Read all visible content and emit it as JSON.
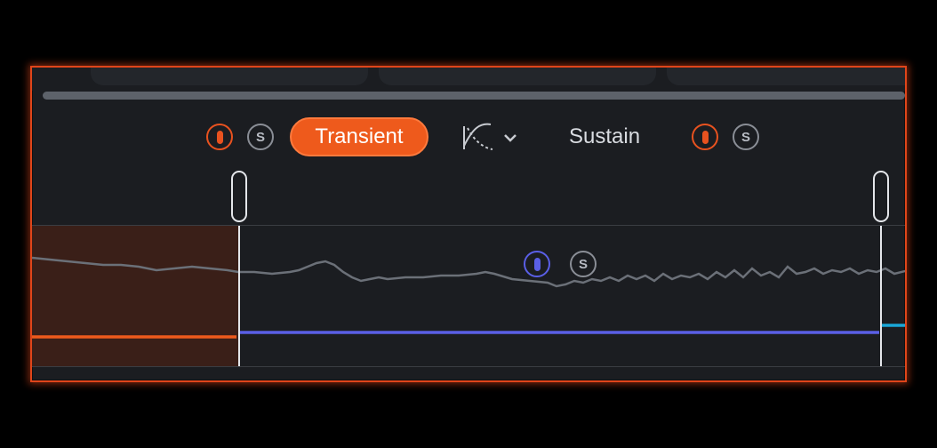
{
  "bands": {
    "transient_label": "Transient",
    "sustain_label": "Sustain",
    "transient_mute_icon": "mute-icon",
    "transient_solo_label": "S",
    "sustain_mute_icon": "mute-icon",
    "sustain_solo_label": "S",
    "curve_icon": "curve-shape-icon",
    "curve_dropdown_icon": "chevron-down-icon",
    "middle_solo_label": "S"
  },
  "colors": {
    "accent_orange": "#ee5a1c",
    "band_blue": "#5a5fe6",
    "band_cyan": "#1aa7d8",
    "panel_bg": "#1b1d21"
  }
}
